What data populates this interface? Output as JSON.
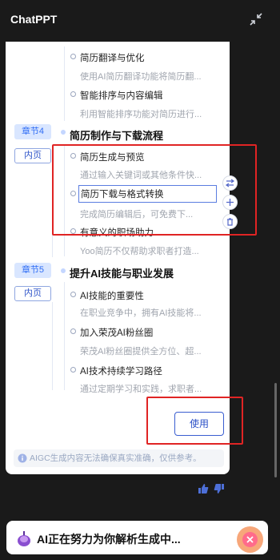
{
  "app": {
    "title": "ChatPPT",
    "collapse_icon": "collapse-arrows-icon"
  },
  "outline": {
    "pre_items": [
      {
        "title": "简历翻译与优化",
        "desc": "使用AI简历翻译功能将简历翻..."
      },
      {
        "title": "智能排序与内容编辑",
        "desc": "利用智能排序功能对简历进行..."
      }
    ],
    "chapters": [
      {
        "badge": "章节4",
        "title": "简历制作与下载流程",
        "type": "内页",
        "items": [
          {
            "title": "简历生成与预览",
            "desc": "通过输入关键词或其他条件快..."
          },
          {
            "title": "简历下载与格式转换",
            "desc": "完成简历编辑后，可免费下..."
          },
          {
            "title": "有意义的职场助力",
            "desc": "Yoo简历不仅帮助求职者打造..."
          }
        ]
      },
      {
        "badge": "章节5",
        "title": "提升AI技能与职业发展",
        "type": "内页",
        "items": [
          {
            "title": "AI技能的重要性",
            "desc": "在职业竞争中，拥有AI技能将..."
          },
          {
            "title": "加入荣茂AI粉丝圈",
            "desc": "荣茂AI粉丝圈提供全方位、超..."
          },
          {
            "title": "AI技术持续学习路径",
            "desc": "通过定期学习和实践，求职者..."
          }
        ]
      }
    ]
  },
  "float_tools": [
    "list-swap-icon",
    "add-icon",
    "delete-icon"
  ],
  "use_button": "使用",
  "disclaimer": "AIGC生成内容无法确保真实准确，仅供参考。",
  "feedback": {
    "like": "thumb-up-icon",
    "dislike": "thumb-down-icon"
  },
  "status": {
    "text": "AI正在努力为你解析生成中...",
    "stop_icon": "stop-close-icon"
  },
  "colors": {
    "accent": "#2f6df5",
    "highlight_box": "#e02424",
    "background": "#1a1a1a"
  }
}
